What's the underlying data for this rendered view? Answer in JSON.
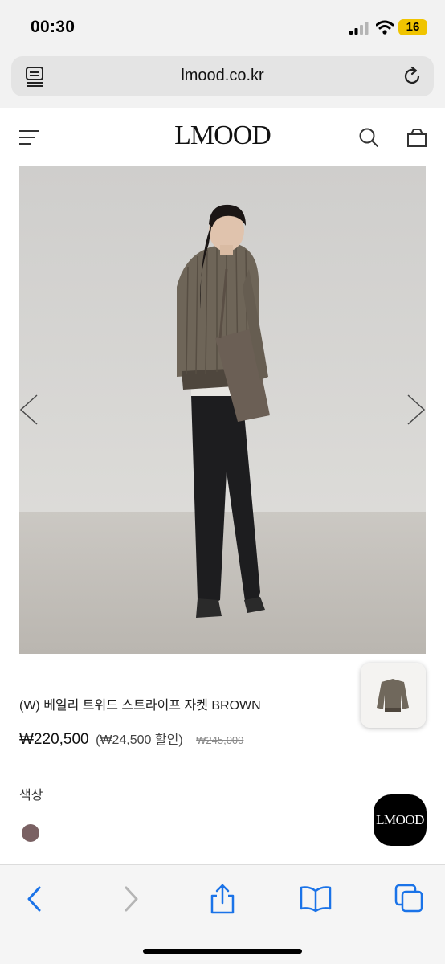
{
  "status_bar": {
    "time": "00:30",
    "battery": "16"
  },
  "browser": {
    "url": "lmood.co.kr"
  },
  "site": {
    "logo": "LMOOD"
  },
  "product": {
    "name": "(W) 베일리 트위드 스트라이프 자켓 BROWN",
    "price": "₩220,500",
    "discount": "(₩24,500 할인)",
    "original_price": "₩245,000",
    "color_label": "색상",
    "swatch_color": "#7a6163"
  },
  "floating": {
    "logo": "LMOOD"
  },
  "icons": {
    "status": [
      "signal-icon",
      "wifi-icon"
    ],
    "address": [
      "reader-icon",
      "reload-icon"
    ],
    "header": [
      "menu-icon",
      "search-icon",
      "bag-icon"
    ],
    "carousel": [
      "chevron-left-icon",
      "chevron-right-icon"
    ],
    "toolbar": [
      "back-icon",
      "forward-icon",
      "share-icon",
      "bookmarks-icon",
      "tabs-icon"
    ]
  },
  "colors": {
    "accent": "#1a73e8",
    "battery": "#f0c400"
  }
}
